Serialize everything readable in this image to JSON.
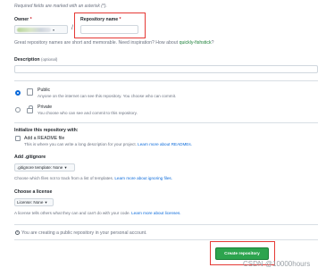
{
  "form": {
    "required_note": "Required fields are marked with an asterisk (*).",
    "owner_label": "Owner",
    "repo_label": "Repository name",
    "asterisk": "*",
    "slash": "/",
    "suggestion": {
      "text": "Great repository names are short and memorable. Need inspiration? How about",
      "name": "quickly-fishstick",
      "end": "?"
    },
    "description_label": "Description",
    "optional": "(optional)",
    "visibility": {
      "public_title": "Public",
      "public_desc": "Anyone on the internet can see this repository. You choose who can commit.",
      "private_title": "Private",
      "private_desc": "You choose who can see and commit to this repository."
    },
    "init": {
      "heading": "Initialize this repository with:",
      "readme_label": "Add a README file",
      "readme_desc": "This is where you can write a long description for your project.",
      "readme_link": "Learn more about READMEs."
    },
    "gitignore": {
      "heading": "Add .gitignore",
      "select_value": ".gitignore template: None",
      "desc": "Choose which files not to track from a list of templates.",
      "link": "Learn more about ignoring files."
    },
    "license": {
      "heading": "Choose a license",
      "select_value": "License: None",
      "desc": "A license tells others what they can and can't do with your code.",
      "link": "Learn more about licenses."
    },
    "info_text": "You are creating a public repository in your personal account.",
    "create_button": "Create repository"
  },
  "watermark": "CSDN @10000hours",
  "colors": {
    "primary_button": "#2da44e",
    "highlight_box": "#e53935",
    "link": "#0969da"
  }
}
